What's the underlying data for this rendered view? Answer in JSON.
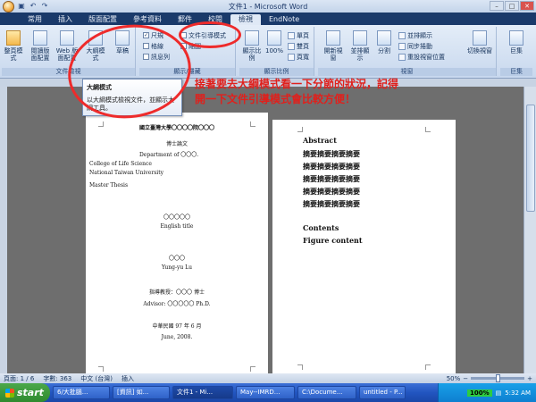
{
  "window": {
    "title": "文件1 - Microsoft Word"
  },
  "tabs": [
    "常用",
    "插入",
    "版面配置",
    "參考資料",
    "郵件",
    "校閱",
    "檢視",
    "EndNote"
  ],
  "active_tab": 6,
  "ribbon": {
    "views": {
      "label": "文件檢視",
      "buttons": [
        "整頁模式",
        "閱讀版面配置",
        "Web 版面配置",
        "大綱模式",
        "草稿"
      ]
    },
    "show_hide": {
      "label": "顯示/隱藏",
      "items": [
        "尺規",
        "格線",
        "訊息列",
        "文件引導模式",
        "縮圖"
      ]
    },
    "zoom": {
      "label": "顯示比例",
      "items": [
        "顯示比例",
        "100%",
        "單頁",
        "雙頁",
        "頁寬"
      ]
    },
    "window": {
      "label": "視窗",
      "items": [
        "開新視窗",
        "並排顯示",
        "分割",
        "並排顯示",
        "同步捲動",
        "重設視窗位置",
        "切換視窗"
      ]
    },
    "macros": {
      "label": "巨集",
      "items": [
        "巨集"
      ]
    }
  },
  "tooltip": {
    "title": "大綱模式",
    "body": "以大綱模式檢視文件，並顯示大綱工具。"
  },
  "annotation": {
    "text": "接著要去大綱模式看一下分節的狀況，記得開一下文件引導模式會比較方便！"
  },
  "page1": {
    "lines": [
      "國立臺灣大學〇〇〇〇院〇〇〇",
      "博士論文",
      "Department of 〇〇〇.",
      "College of Life Science",
      "National Taiwan University",
      "Master Thesis",
      "〇〇〇〇〇",
      "English title",
      "〇〇〇",
      "Yung-yu Lu",
      "指導教授：〇〇〇 博士",
      "Advisor: 〇〇〇〇〇 Ph.D.",
      "中華民國 97 年 6 月",
      "June, 2008."
    ]
  },
  "page2": {
    "abstract_title": "Abstract",
    "abstract_lines": [
      "摘要摘要摘要摘要",
      "摘要摘要摘要摘要",
      "摘要摘要摘要摘要",
      "摘要摘要摘要摘要",
      "摘要摘要摘要摘要"
    ],
    "contents": "Contents",
    "figure_content": "Figure content"
  },
  "status": {
    "page": "頁面: 1 / 6",
    "words": "字數: 363",
    "language": "中文 (台灣)",
    "mode": "插入",
    "zoom": "50%"
  },
  "taskbar": {
    "start": "start",
    "tasks": [
      "6/大批腦...",
      "[資訊] 如...",
      "文件1 - Mi...",
      "May--IMRD...",
      "C:\\Docume...",
      "untitled - P..."
    ],
    "battery": "100%",
    "clock": "5:32 AM"
  }
}
